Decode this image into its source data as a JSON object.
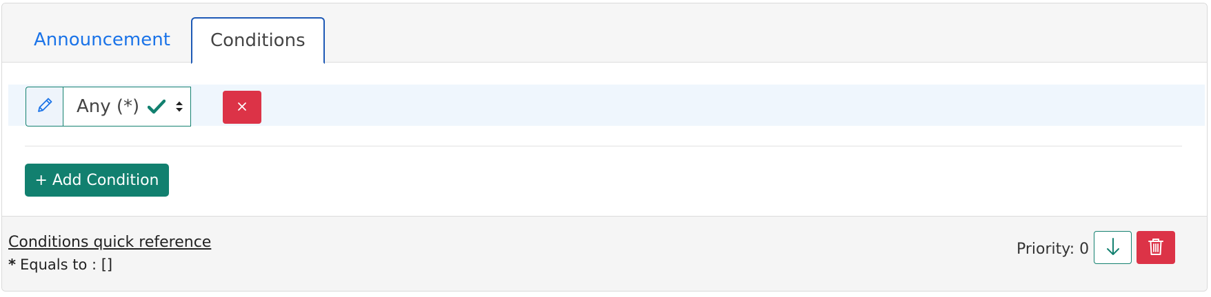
{
  "tabs": [
    {
      "label": "Announcement"
    },
    {
      "label": "Conditions"
    }
  ],
  "condition": {
    "selected_value": "Any (*)",
    "edit_icon": "pencil-icon",
    "check_icon": "check-icon",
    "remove_icon": "close-icon"
  },
  "actions": {
    "add_condition_label": "+ Add Condition"
  },
  "footer": {
    "reference_link": "Conditions quick reference",
    "reference_star": "*",
    "reference_text": "Equals to : []",
    "priority_label": "Priority: 0",
    "move_down_icon": "arrow-down-icon",
    "delete_icon": "trash-icon"
  },
  "colors": {
    "primary_green": "#12806f",
    "danger_red": "#dc3347",
    "link_blue": "#1a73e8",
    "row_highlight": "#eff6fd"
  }
}
